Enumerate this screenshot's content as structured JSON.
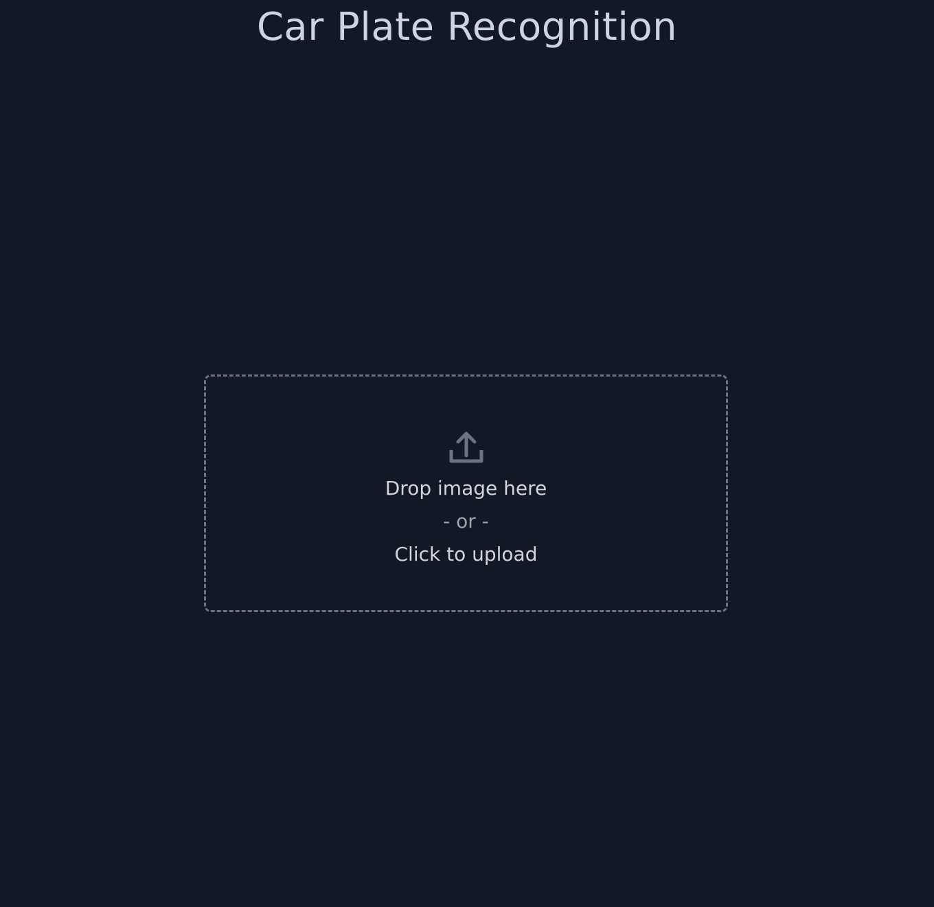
{
  "header": {
    "title": "Car Plate Recognition"
  },
  "upload": {
    "icon": "upload-icon",
    "drop_label": "Drop image here",
    "separator": "- or -",
    "click_label": "Click to upload"
  },
  "colors": {
    "background": "#121826",
    "title": "#cbd5e1",
    "border": "#6b7280",
    "icon": "#6b7280",
    "text": "#d1d5db",
    "muted_text": "#9ca3af"
  }
}
